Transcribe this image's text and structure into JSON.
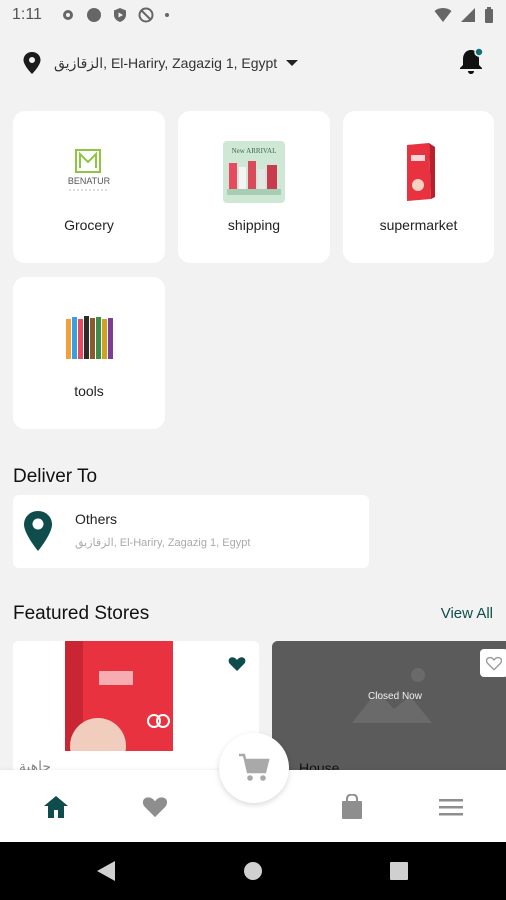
{
  "status_bar": {
    "time": "1:11"
  },
  "location": {
    "address": "الزقازيق, El-Hariry, Zagazig 1, Egypt"
  },
  "categories": [
    {
      "label": "Grocery",
      "logo_text": "BENATUR"
    },
    {
      "label": "shipping",
      "promo_text": "New ARRIVAL"
    },
    {
      "label": "supermarket"
    },
    {
      "label": "tools"
    }
  ],
  "deliver": {
    "section_title": "Deliver To",
    "title": "Others",
    "address": "الزقازيق, El-Hariry, Zagazig 1, Egypt"
  },
  "featured": {
    "section_title": "Featured Stores",
    "view_all": "View All",
    "stores": [
      {
        "name": "جاهية",
        "favorited": true
      },
      {
        "name": "House",
        "status": "Closed Now",
        "favorited": false
      }
    ]
  },
  "colors": {
    "accent": "#0f4c4c",
    "background": "#f2f2f2",
    "inactive": "#8e8e8e"
  },
  "bottom_nav": {
    "items": [
      "home-icon",
      "heart-icon",
      "cart-icon",
      "bag-icon",
      "menu-icon"
    ]
  }
}
